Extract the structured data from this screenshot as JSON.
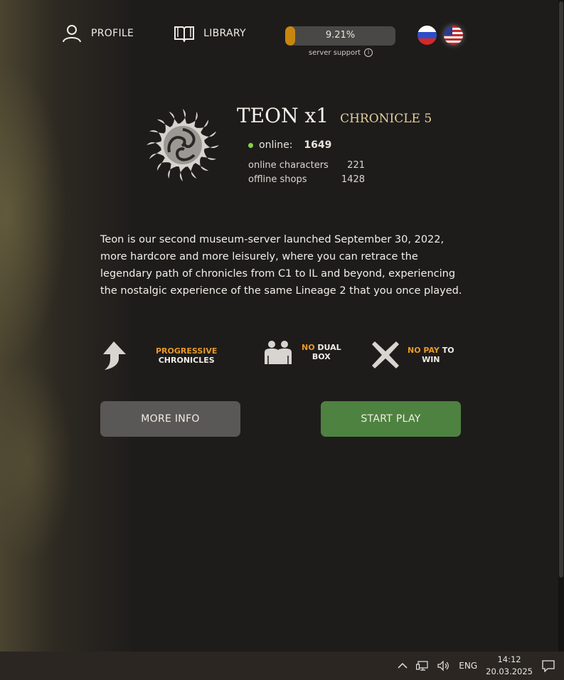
{
  "nav": {
    "profile_label": "PROFILE",
    "library_label": "LIBRARY"
  },
  "support": {
    "percent_text": "9.21%",
    "fraction": 0.0921,
    "label": "server support"
  },
  "languages": [
    {
      "code": "ru",
      "icon": "russia-flag-icon"
    },
    {
      "code": "en",
      "icon": "usa-flag-icon"
    }
  ],
  "server": {
    "name": "TEON x1",
    "chronicle": "CHRONICLE 5",
    "online_label": "online:",
    "online_value": "1649",
    "stats": [
      {
        "label": "online characters",
        "value": "221"
      },
      {
        "label": "offline shops",
        "value": "1428"
      }
    ]
  },
  "description": "Teon is our second museum-server launched September 30, 2022, more hardcore and more leisurely, where you can retrace the legendary path of chronicles from C1 to IL and beyond, experiencing the nostalgic experience of the same Lineage 2 that you once played.",
  "features": [
    {
      "icon": "arrow-up-icon",
      "highlight": "PROGRESSIVE",
      "rest": "CHRONICLES"
    },
    {
      "icon": "two-people-icon",
      "highlight": "NO",
      "rest_inline": "DUAL",
      "rest": "BOX"
    },
    {
      "icon": "cross-icon",
      "highlight": "NO PAY",
      "rest_inline": "TO",
      "rest": "WIN"
    }
  ],
  "buttons": {
    "more_info": "MORE INFO",
    "start_play": "START PLAY"
  },
  "taskbar": {
    "lang": "ENG",
    "time": "14:12",
    "date": "20.03.2025"
  },
  "colors": {
    "accent_orange": "#e89a26",
    "start_green": "#4e8240",
    "online_dot": "#86d14a",
    "chronicle_gold": "#e4cf9b"
  }
}
